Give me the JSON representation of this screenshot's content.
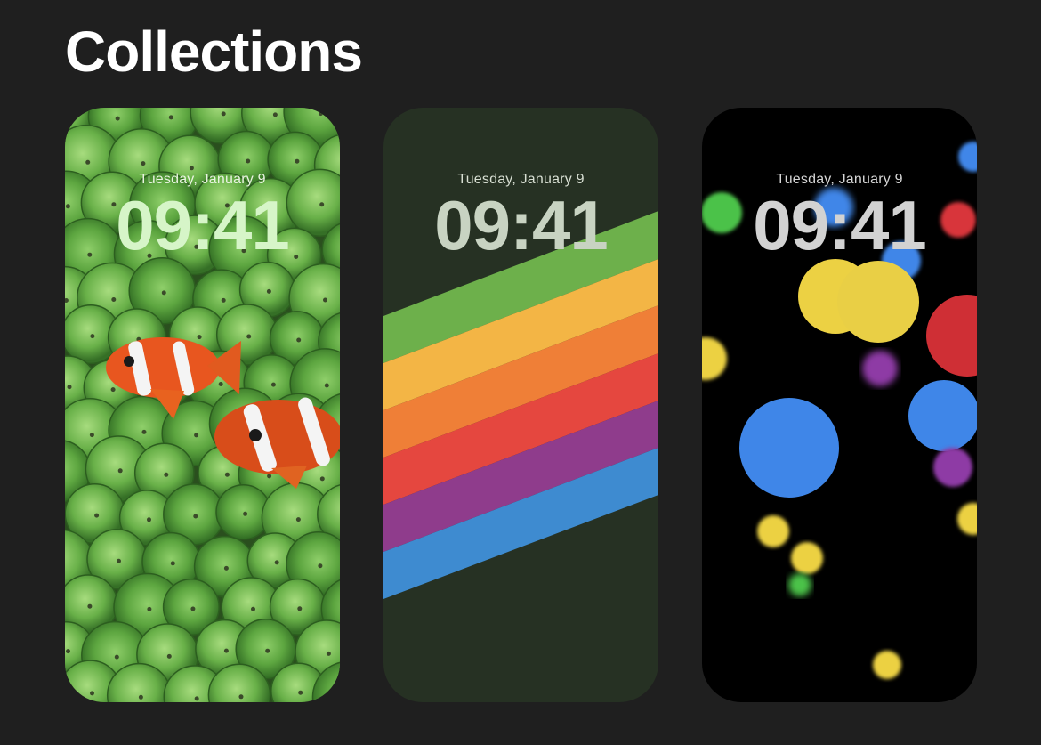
{
  "header": {
    "title": "Collections"
  },
  "wallpapers": [
    {
      "name": "Clownfish",
      "date": "Tuesday, January 9",
      "time": "09:41"
    },
    {
      "name": "Rainbow stripes",
      "date": "Tuesday, January 9",
      "time": "09:41"
    },
    {
      "name": "Color dots",
      "date": "Tuesday, January 9",
      "time": "09:41"
    }
  ],
  "colors": {
    "background": "#1f1f1f",
    "stripe_green": "#6db04b",
    "stripe_yellow": "#f3b545",
    "stripe_orange": "#ef7f37",
    "stripe_red": "#e5473f",
    "stripe_purple": "#8f3c8c",
    "stripe_blue": "#3e8bd0"
  }
}
